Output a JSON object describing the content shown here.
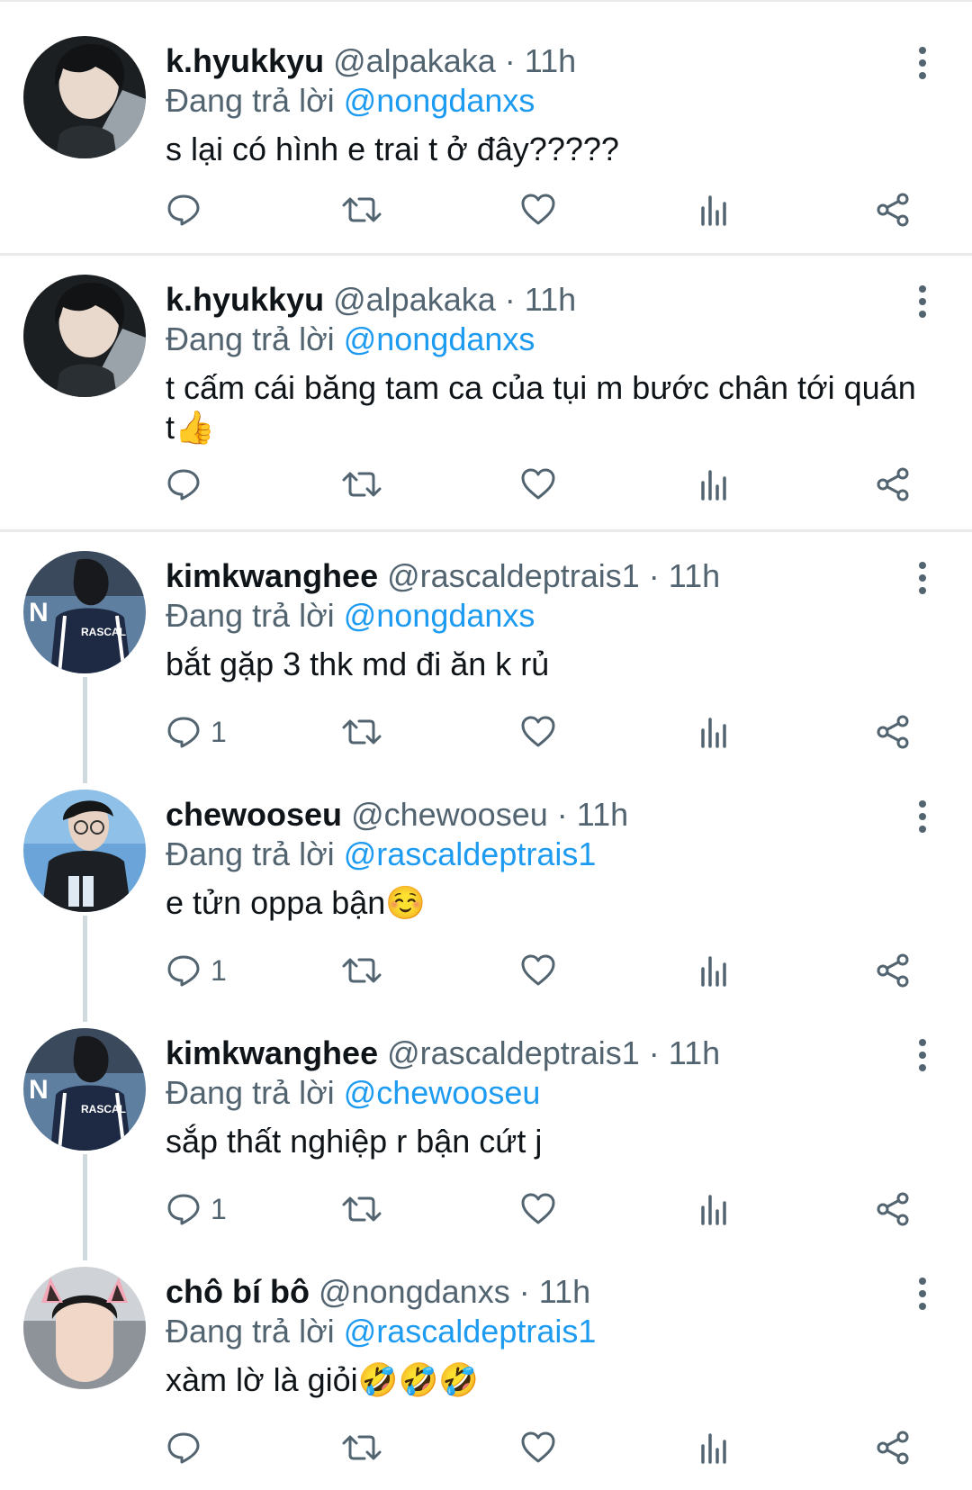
{
  "reply_prefix": "Đang trả lời",
  "tweets": [
    {
      "name": "k.hyukkyu",
      "handle": "@alpakaka",
      "time": "· 11h",
      "reply_to": "@nongdanxs",
      "text": "s lại có hình e trai t ở đây?????",
      "emoji": "",
      "reply_count": "",
      "avatar": "avatar-khyukkyu"
    },
    {
      "name": "k.hyukkyu",
      "handle": "@alpakaka",
      "time": "· 11h",
      "reply_to": "@nongdanxs",
      "text_line1": "t cấm cái băng tam ca của tụi m bước chân tới quán",
      "text_line2": "t",
      "emoji": "👍",
      "reply_count": "",
      "avatar": "avatar-khyukkyu"
    },
    {
      "name": "kimkwanghee",
      "handle": "@rascaldeptrais1",
      "time": "· 11h",
      "reply_to": "@nongdanxs",
      "text": "bắt gặp 3 thk md đi ăn k rủ",
      "emoji": "",
      "reply_count": "1",
      "avatar": "avatar-kimkwanghee",
      "avatar_jacket_text": "RASCAL"
    },
    {
      "name": "chewooseu",
      "handle": "@chewooseu",
      "time": "· 11h",
      "reply_to": "@rascaldeptrais1",
      "text": "e tửn oppa bận",
      "emoji": "☺️",
      "reply_count": "1",
      "avatar": "avatar-chewooseu"
    },
    {
      "name": "kimkwanghee",
      "handle": "@rascaldeptrais1",
      "time": "· 11h",
      "reply_to": "@chewooseu",
      "text": "sắp thất nghiệp r bận cứt j",
      "emoji": "",
      "reply_count": "1",
      "avatar": "avatar-kimkwanghee",
      "avatar_jacket_text": "RASCAL"
    },
    {
      "name": "chô bí bô",
      "handle": "@nongdanxs",
      "time": "· 11h",
      "reply_to": "@rascaldeptrais1",
      "text": "xàm lờ là giỏi",
      "emoji": "🤣🤣🤣",
      "reply_count": "",
      "avatar": "avatar-chobibo"
    }
  ],
  "icons": [
    "reply-icon",
    "retweet-icon",
    "like-icon",
    "views-icon",
    "share-icon",
    "more-icon"
  ],
  "colors": {
    "link": "#1d9bf0",
    "secondary_text": "#536471",
    "primary_text": "#0f1419",
    "divider": "#e8eaec",
    "thread_line": "#cfd9de"
  }
}
